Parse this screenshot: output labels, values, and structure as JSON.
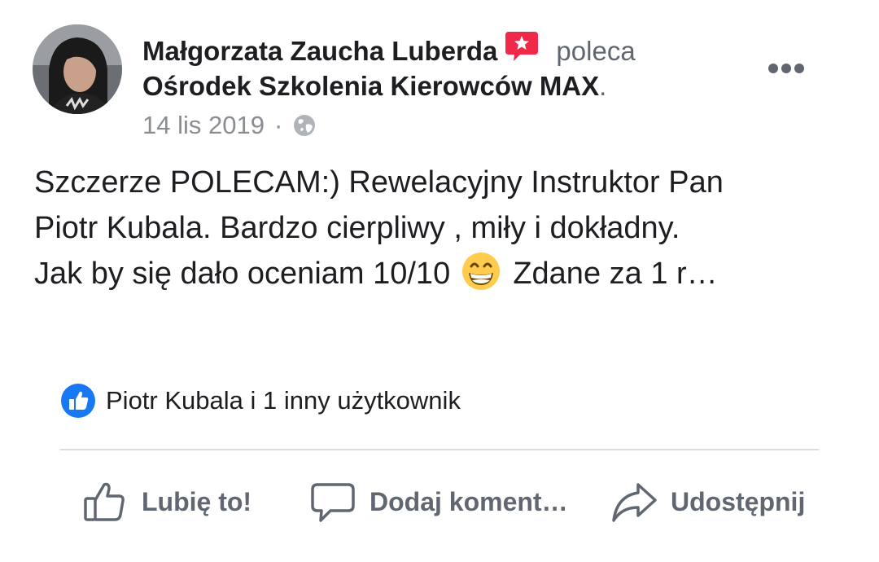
{
  "post": {
    "author": "Małgorzata Zaucha Luberda",
    "action": "poleca",
    "page": "Ośrodek Szkolenia Kierowców MAX",
    "page_suffix": ".",
    "date": "14 lis 2019",
    "separator": "·",
    "privacy_icon": "globe-icon",
    "recommend_icon": "recommendation-icon",
    "text_lines": [
      "Szczerze POLECAM:) Rewelacyjny Instruktor Pan",
      "Piotr Kubala. Bardzo cierpliwy , miły i dokładny.",
      "Jak by się dało oceniam 10/10"
    ],
    "text_tail": "Zdane za 1 r…",
    "emoji": "grinning-face-emoji"
  },
  "reactions": {
    "text": "Piotr Kubala i 1 inny użytkownik",
    "icon": "like-badge-icon"
  },
  "actions": {
    "like": "Lubię to!",
    "comment": "Dodaj koment…",
    "share": "Udostępnij"
  },
  "colors": {
    "text_primary": "#1c1e21",
    "text_secondary": "#606770",
    "meta": "#8a8d91",
    "like_blue": "#1877f2",
    "recommend_red": "#f02849",
    "divider": "#dadde1"
  }
}
